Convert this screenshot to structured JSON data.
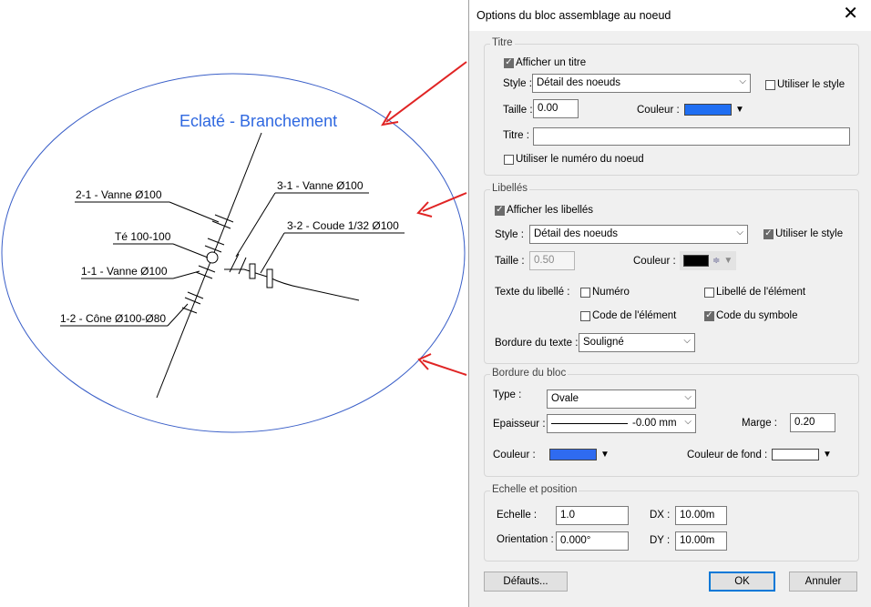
{
  "drawing": {
    "title": "Eclaté - Branchement",
    "labels": [
      "2-1 - Vanne Ø100",
      "Té 100-100",
      "1-1 - Vanne Ø100",
      "1-2 - Cône Ø100-Ø80",
      "3-1 - Vanne Ø100",
      "3-2 - Coude 1/32 Ø100"
    ]
  },
  "dialog": {
    "title": "Options du bloc assemblage au noeud",
    "titre": {
      "legend": "Titre",
      "show_label": "Afficher un titre",
      "show_checked": true,
      "style_label": "Style :",
      "style_value": "Détail des noeuds",
      "use_style_label": "Utiliser le style",
      "use_style_checked": false,
      "size_label": "Taille :",
      "size_value": "0.00",
      "color_label": "Couleur :",
      "color": "#1f6ef2",
      "title_label": "Titre :",
      "title_value": "",
      "use_number_label": "Utiliser le numéro du noeud",
      "use_number_checked": false
    },
    "libelles": {
      "legend": "Libellés",
      "show_label": "Afficher les libellés",
      "show_checked": true,
      "style_label": "Style :",
      "style_value": "Détail des noeuds",
      "use_style_label": "Utiliser le style",
      "use_style_checked": true,
      "size_label": "Taille :",
      "size_value": "0.50",
      "color_label": "Couleur :",
      "color": "#000000",
      "text_label": "Texte du libellé :",
      "numero_label": "Numéro",
      "numero_checked": false,
      "libelle_elem_label": "Libellé de l'élément",
      "libelle_elem_checked": false,
      "code_elem_label": "Code de l'élément",
      "code_elem_checked": false,
      "code_symbole_label": "Code du symbole",
      "code_symbole_checked": true,
      "border_label": "Bordure du texte :",
      "border_value": "Souligné"
    },
    "bordure": {
      "legend": "Bordure du bloc",
      "type_label": "Type :",
      "type_value": "Ovale",
      "thickness_label": "Epaisseur :",
      "thickness_value": "-0.00 mm",
      "margin_label": "Marge :",
      "margin_value": "0.20",
      "color_label": "Couleur :",
      "color": "#2f6bf0",
      "bg_label": "Couleur de fond :",
      "bg_color": "#ffffff"
    },
    "echelle": {
      "legend": "Echelle et position",
      "scale_label": "Echelle :",
      "scale_value": "1.0",
      "dx_label": "DX :",
      "dx_value": "10.00m",
      "orient_label": "Orientation :",
      "orient_value": "0.000°",
      "dy_label": "DY :",
      "dy_value": "10.00m"
    },
    "buttons": {
      "defaults": "Défauts...",
      "ok": "OK",
      "cancel": "Annuler"
    }
  }
}
